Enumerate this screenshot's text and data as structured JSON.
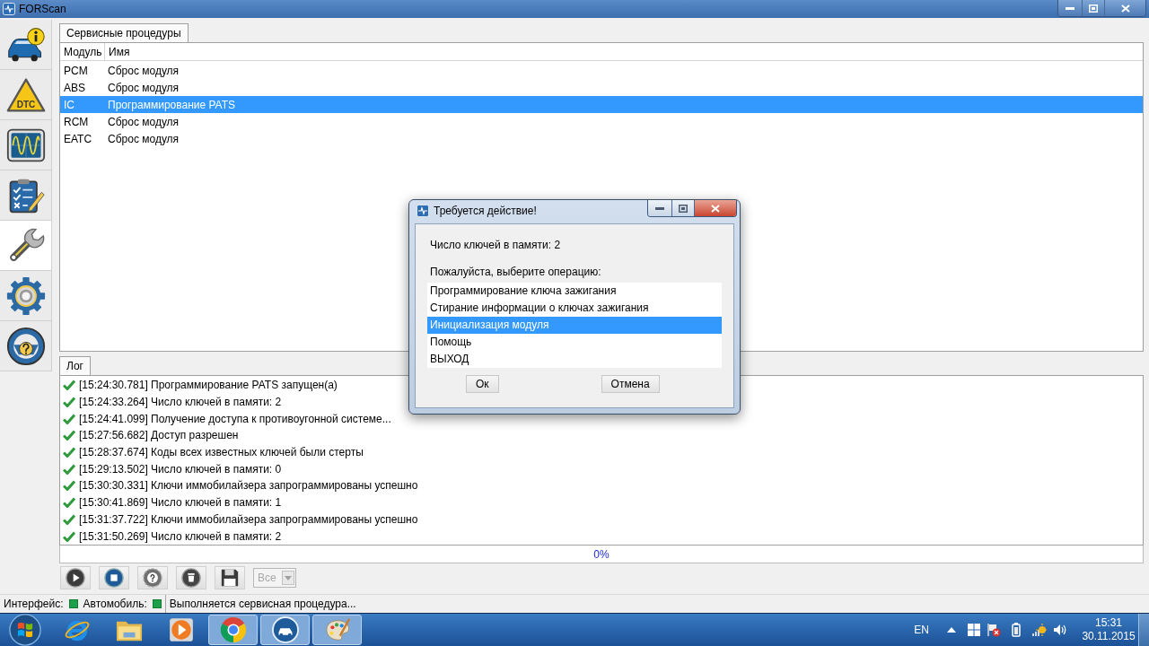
{
  "window": {
    "title": "FORScan"
  },
  "sidebar": {
    "items": [
      {
        "kind": "info",
        "selected": false
      },
      {
        "kind": "dtc",
        "label": "DTC",
        "selected": false
      },
      {
        "kind": "scope",
        "selected": false
      },
      {
        "kind": "checklist",
        "selected": false
      },
      {
        "kind": "wrench",
        "selected": true
      },
      {
        "kind": "gear",
        "selected": false
      },
      {
        "kind": "wheel",
        "selected": false
      }
    ]
  },
  "procedures": {
    "tabs": [
      {
        "label": "Сервисные процедуры",
        "selected": true
      }
    ],
    "columns": [
      "Модуль",
      "Имя"
    ],
    "rows": [
      {
        "module": "PCM",
        "name": "Сброс модуля",
        "selected": false
      },
      {
        "module": "ABS",
        "name": "Сброс модуля",
        "selected": false
      },
      {
        "module": "IC",
        "name": "Программирование PATS",
        "selected": true
      },
      {
        "module": "RCM",
        "name": "Сброс модуля",
        "selected": false
      },
      {
        "module": "EATC",
        "name": "Сброс модуля",
        "selected": false
      }
    ]
  },
  "log": {
    "tabs": [
      {
        "label": "Лог",
        "selected": true
      }
    ],
    "entries": [
      {
        "ok": true,
        "text": "[15:24:30.781] Программирование PATS запущен(а)"
      },
      {
        "ok": true,
        "text": "[15:24:33.264] Число ключей в памяти: 2"
      },
      {
        "ok": true,
        "text": "[15:24:41.099] Получение доступа к противоугонной системе..."
      },
      {
        "ok": true,
        "text": "[15:27:56.682] Доступ разрешен"
      },
      {
        "ok": true,
        "text": "[15:28:37.674] Коды всех известных ключей были стерты"
      },
      {
        "ok": true,
        "text": "[15:29:13.502] Число ключей в памяти: 0"
      },
      {
        "ok": true,
        "text": "[15:30:30.331] Ключи иммобилайзера запрограммированы успешно"
      },
      {
        "ok": true,
        "text": "[15:30:41.869] Число ключей в памяти: 1"
      },
      {
        "ok": true,
        "text": "[15:31:37.722] Ключи иммобилайзера запрограммированы успешно"
      },
      {
        "ok": true,
        "text": "[15:31:50.269] Число ключей в памяти: 2"
      }
    ]
  },
  "progress": {
    "level": 0,
    "reading": "0%"
  },
  "toolbar": {
    "buttons": [
      {
        "kind": "play"
      },
      {
        "kind": "stop"
      },
      {
        "kind": "help"
      },
      {
        "kind": "delete"
      },
      {
        "kind": "save"
      }
    ],
    "filter": {
      "value": "Все",
      "disabled": true
    }
  },
  "status_bar": {
    "indicators": [
      {
        "label": "Интерфейс:",
        "on": true
      },
      {
        "label": "Автомобиль:",
        "on": true
      }
    ],
    "message": "Выполняется сервисная процедура..."
  },
  "dialog": {
    "title": "Требуется действие!",
    "info": "Число ключей в памяти: 2",
    "prompt": "Пожалуйста, выберите операцию:",
    "options": [
      {
        "label": "Программирование ключа зажигания",
        "selected": false
      },
      {
        "label": "Стирание информации о ключах зажигания",
        "selected": false
      },
      {
        "label": "Инициализация модуля",
        "selected": true
      },
      {
        "label": "Помощь",
        "selected": false
      },
      {
        "label": "ВЫХОД",
        "selected": false
      }
    ],
    "buttons": [
      "Ок",
      "Отмена"
    ]
  },
  "taskbar": {
    "apps": [
      {
        "kind": "globe",
        "running": false
      },
      {
        "kind": "folder",
        "running": false
      },
      {
        "kind": "player",
        "running": false
      },
      {
        "kind": "browser",
        "running": true
      },
      {
        "kind": "scanner",
        "running": true
      },
      {
        "kind": "palette",
        "running": true
      }
    ],
    "tray": {
      "language": "EN",
      "time": "15:31",
      "date": "30.11.2015"
    }
  }
}
